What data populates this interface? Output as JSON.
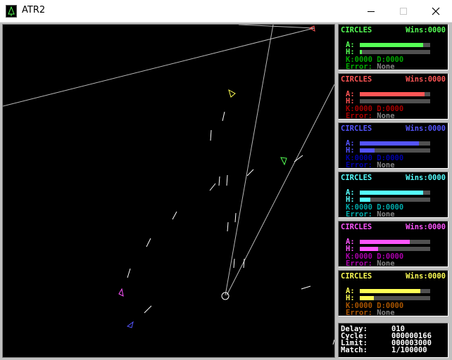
{
  "window": {
    "title": "ATR2"
  },
  "panels": [
    {
      "name": "CIRCLES",
      "wins": "Wins:0000",
      "a_label": "A:",
      "h_label": "H:",
      "armor": 0.9,
      "heat": 0.03,
      "k": "K:0000",
      "d": "D:0000",
      "error_label": "Error:",
      "error_value": "None",
      "color": "#55ff55",
      "dim": "#00aa00"
    },
    {
      "name": "CIRCLES",
      "wins": "Wins:0000",
      "a_label": "A:",
      "h_label": "H:",
      "armor": 0.92,
      "heat": 0.0,
      "k": "K:0000",
      "d": "D:0000",
      "error_label": "Error:",
      "error_value": "None",
      "color": "#ff5555",
      "dim": "#aa0000"
    },
    {
      "name": "CIRCLES",
      "wins": "Wins:0000",
      "a_label": "A:",
      "h_label": "H:",
      "armor": 0.84,
      "heat": 0.21,
      "k": "K:0000",
      "d": "D:0000",
      "error_label": "Error:",
      "error_value": "None",
      "color": "#5555ff",
      "dim": "#0000aa"
    },
    {
      "name": "CIRCLES",
      "wins": "Wins:0000",
      "a_label": "A:",
      "h_label": "H:",
      "armor": 0.9,
      "heat": 0.15,
      "k": "K:0000",
      "d": "D:0000",
      "error_label": "Error:",
      "error_value": "None",
      "color": "#55ffff",
      "dim": "#00aaaa"
    },
    {
      "name": "CIRCLES",
      "wins": "Wins:0000",
      "a_label": "A:",
      "h_label": "H:",
      "armor": 0.71,
      "heat": 0.26,
      "k": "K:0000",
      "d": "D:0000",
      "error_label": "Error:",
      "error_value": "None",
      "color": "#ff55ff",
      "dim": "#aa00aa"
    },
    {
      "name": "CIRCLES",
      "wins": "Wins:0000",
      "a_label": "A:",
      "h_label": "H:",
      "armor": 0.86,
      "heat": 0.2,
      "k": "K:0000",
      "d": "D:0000",
      "error_label": "Error:",
      "error_value": "None",
      "color": "#ffff55",
      "dim": "#aa5500"
    }
  ],
  "status": {
    "delay_label": "Delay:",
    "delay": "010",
    "cycle_label": "Cycle:",
    "cycle": "000000166",
    "limit_label": "Limit:",
    "limit": "000003000",
    "match_label": "Match:",
    "match": "1/100000"
  },
  "robot_colors": {
    "green": "#55ff55",
    "red": "#ff5555",
    "blue": "#5555ff",
    "cyan": "#55ffff",
    "magenta": "#ff55ff",
    "yellow": "#ffff55"
  }
}
